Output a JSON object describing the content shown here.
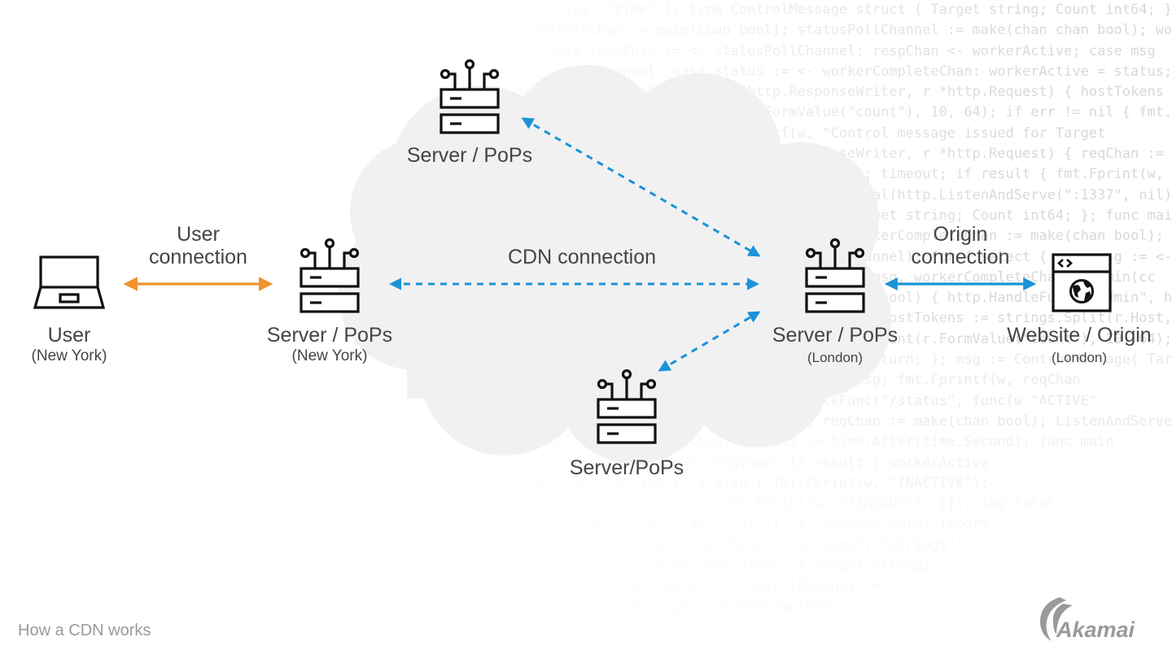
{
  "caption": "How a CDN works",
  "brand": {
    "name": "Akamai",
    "color": "#9a9a9a"
  },
  "colors": {
    "user_connection": "#f0942f",
    "cdn_connection": "#1b93d6",
    "origin_connection": "#1b93d6",
    "cloud": "#f1f1f2",
    "icon_stroke": "#111111",
    "text": "#444444"
  },
  "nodes": {
    "user": {
      "title": "User",
      "location": "(New York)",
      "icon": "laptop-icon"
    },
    "server_ny": {
      "title": "Server / PoPs",
      "location": "(New York)",
      "icon": "server-icon"
    },
    "server_top": {
      "title": "Server / PoPs",
      "icon": "server-icon"
    },
    "server_bottom": {
      "title": "Server/PoPs",
      "icon": "server-icon"
    },
    "server_london": {
      "title": "Server / PoPs",
      "location": "(London)",
      "icon": "server-icon"
    },
    "origin": {
      "title": "Website / Origin",
      "location": "(London)",
      "icon": "website-globe-icon"
    }
  },
  "connections": {
    "user": {
      "line1": "User",
      "line2": "connection",
      "style": "solid"
    },
    "cdn": {
      "label": "CDN connection",
      "style": "dashed"
    },
    "origin": {
      "line1": "Origin",
      "line2": "connection",
      "style": "solid"
    }
  },
  "background_code": [
    "message\" \"string\" \"time\" ); type ControlMessage struct { Target string; Count int64; }",
    "  workerCompleteChan := make(chan bool); statusPollChannel := make(chan chan bool); workerActive",
    "  select { case respChan := <- statusPollChannel: respChan <- workerActive; case msg",
    "    := <- controlChannel: case status := <- workerCompleteChan: workerActive = status; }}",
    "  http.HandleFunc(\"/admin\", func(w http.ResponseWriter, r *http.Request) { hostTokens",
    "    count, err := strconv.ParseInt(r.FormValue(\"count\"), 10, 64); if err != nil { fmt.Fprintf(w,",
    "    err.Error()); return; }; fmt.Fprintf(w, \"Control message issued for Target",
    "  http.HandleFunc(\"/status\",func(w http.ResponseWriter, r *http.Request) { reqChan :=",
    "    make(chan bool); statusPollChannel <- reqChan; timeout; if result { fmt.Fprint(w, \"ACTIVE\"",
    "    } else { fmt.Fprint(w, \"INACTIVE\"); }; log.Fatal(http.ListenAndServe(\":1337\", nil)); };package",
    "  import ( \"fmt\"; type ControlMessage struct { Target string; Count int64; }; func main()",
    "  controlChannel := make(chan ControlMessage); workerCompleteChan := make(chan bool); workerActive",
    "  := false; go admin(controlChannel, statusPollChannel); for { select { case msg := <-",
    "  controlChannel: workerActive = true; go doStuff(msg, workerCompleteChan); admin(cc",
    "  chan ControlMessage, statusPollChannel chan chan bool) { http.HandleFunc(\"/admin\", hostTokens",
    "    func(w http.ResponseWriter, r *http.Request) { hostTokens := strings.Split(r.Host,",
    "    \":\"); r.ParseForm(); count, err := strconv.ParseInt(r.FormValue(\"count\"), 10, 64); fmt.Fprintf(w,",
    "    if err != nil { fmt.Fprintf(w, err.Error()); return; }; msg := ControlMessage{ Target:",
    "    r.FormValue(\"target\"), Count: count}; cc <- msg; fmt.Fprintf(w, reqChan",
    "    \"Control message issued\"); }); http.HandleFunc(\"/status\", func(w \"ACTIVE\"",
    "    http.ResponseWriter, r *http.Request) { reqChan := make(chan bool); ListenAndServe",
    "    statusPollChannel <- reqChan; timeout := time.After(time.Second); func main",
    "    select { case result := <- reqChan: if result { workerActive",
    "    fmt.Fprint(w, \"ACTIVE\"); } else { fmt.Fprint(w, \"INACTIVE\");",
    "    }; return; case <- timeout: fmt.Fprint(w, \"TIMEOUT\"); }}); log.Fatal",
    "    (http.ListenAndServe(\":1337\", nil)); }; package main; import",
    "    ( \"fmt\"; \"html\"; \"log\"; \"net/http\"; \"strconv\"; \"strings\";",
    "    \"time\" ); type ControlMessage struct { Target string;",
    "    Count int64; }; func main() { controlChannel :=",
    "    make(chan ControlMessage); workerComplete"
  ]
}
